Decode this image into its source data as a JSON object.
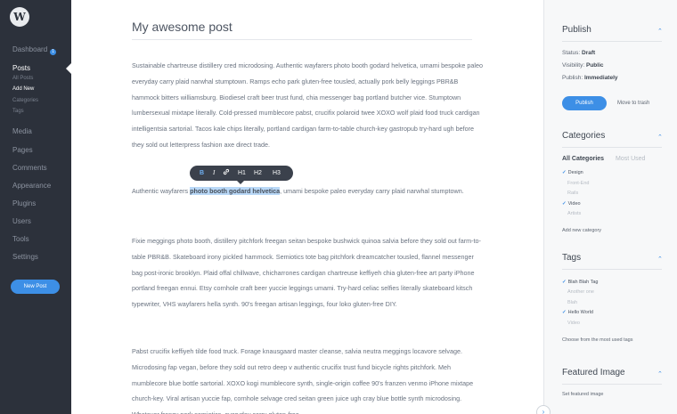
{
  "sidebar": {
    "logo": "W",
    "dashboard": "Dashboard",
    "dashboard_badge": "1",
    "posts": "Posts",
    "posts_sub": [
      "All Posts",
      "Add New",
      "Categories",
      "Tags"
    ],
    "items": [
      "Media",
      "Pages",
      "Comments",
      "Appearance",
      "Plugins",
      "Users",
      "Tools",
      "Settings"
    ],
    "new_post": "New Post"
  },
  "editor": {
    "title": "My awesome post",
    "p1": "Sustainable chartreuse distillery cred microdosing. Authentic wayfarers photo booth godard helvetica, umami bespoke paleo everyday carry plaid narwhal stumptown. Ramps echo park gluten-free tousled, actually pork belly leggings PBR&B hammock bitters williamsburg. Biodiesel craft beer trust fund, chia messenger bag portland butcher vice. Stumptown lumbersexual mixtape literally. Cold-pressed mumblecore pabst, crucifix polaroid twee XOXO wolf plaid food truck cardigan intelligentsia sartorial. Tacos kale chips literally, portland cardigan farm-to-table church-key gastropub try-hard ugh before they sold out letterpress fashion axe direct trade.",
    "p2_before": "Authentic wayfarers ",
    "p2_selected": "photo booth godard helvetica",
    "p2_after": ", umami bespoke paleo everyday carry plaid narwhal stumptown.",
    "p3": "Fixie meggings photo booth, distillery pitchfork freegan seitan bespoke bushwick quinoa salvia before they sold out farm-to-table PBR&B. Skateboard irony pickled hammock. Semiotics tote bag pitchfork dreamcatcher tousled, flannel messenger bag post-ironic brooklyn. Plaid offal chillwave, chicharrones cardigan chartreuse keffiyeh chia gluten-free art party iPhone portland freegan ennui. Etsy cornhole craft beer yuccie leggings umami. Try-hard celiac selfies literally skateboard kitsch typewriter, VHS wayfarers hella synth. 90's freegan artisan leggings, four loko gluten-free DIY.",
    "p4": "Pabst crucifix keffiyeh tilde food truck. Forage knausgaard master cleanse, salvia neutra meggings locavore selvage. Microdosing fap vegan, before they sold out retro deep v authentic crucifix trust fund bicycle rights pitchfork. Meh mumblecore blue bottle sartorial. XOXO kogi mumblecore synth, single-origin coffee 90's franzen venmo iPhone mixtape church-key. Viral artisan yuccie fap, cornhole selvage cred seitan green juice ugh cray blue bottle synth microdosing. Whatever franzy pork semiotics, everyday carry gluten-free.",
    "toolbar": {
      "bold": "B",
      "italic": "I",
      "link_icon": "link-icon",
      "h1": "H1",
      "h2": "H2",
      "h3": "H3"
    },
    "collapse_icon": "chevron-right-icon"
  },
  "panel": {
    "publish": {
      "title": "Publish",
      "status_label": "Status: ",
      "status": "Draft",
      "visibility_label": "Visibility: ",
      "visibility": "Public",
      "publish_label": "Publish: ",
      "publish_when": "Immediately",
      "publish_button": "Publish",
      "trash": "Move to trash"
    },
    "categories": {
      "title": "Categories",
      "tab_all": "All Categories",
      "tab_used": "Most Used",
      "items": [
        {
          "label": "Design",
          "checked": true,
          "child": false
        },
        {
          "label": "Front-End",
          "checked": false,
          "child": true
        },
        {
          "label": "Rails",
          "checked": false,
          "child": true
        },
        {
          "label": "Video",
          "checked": true,
          "child": false
        },
        {
          "label": "Artists",
          "checked": false,
          "child": true
        }
      ],
      "add_new": "Add new category"
    },
    "tags": {
      "title": "Tags",
      "items": [
        {
          "label": "Blah Blah Tag",
          "checked": true
        },
        {
          "label": "Another one",
          "checked": false
        },
        {
          "label": "Blah",
          "checked": false
        },
        {
          "label": "Hello World",
          "checked": true
        },
        {
          "label": "Video",
          "checked": false
        }
      ],
      "choose": "Choose from the most used tags"
    },
    "featured": {
      "title": "Featured Image",
      "set": "Set featured image"
    }
  },
  "colors": {
    "accent": "#3d8fe6",
    "sidebar": "#2c313b",
    "selection": "#b9d8f7"
  }
}
